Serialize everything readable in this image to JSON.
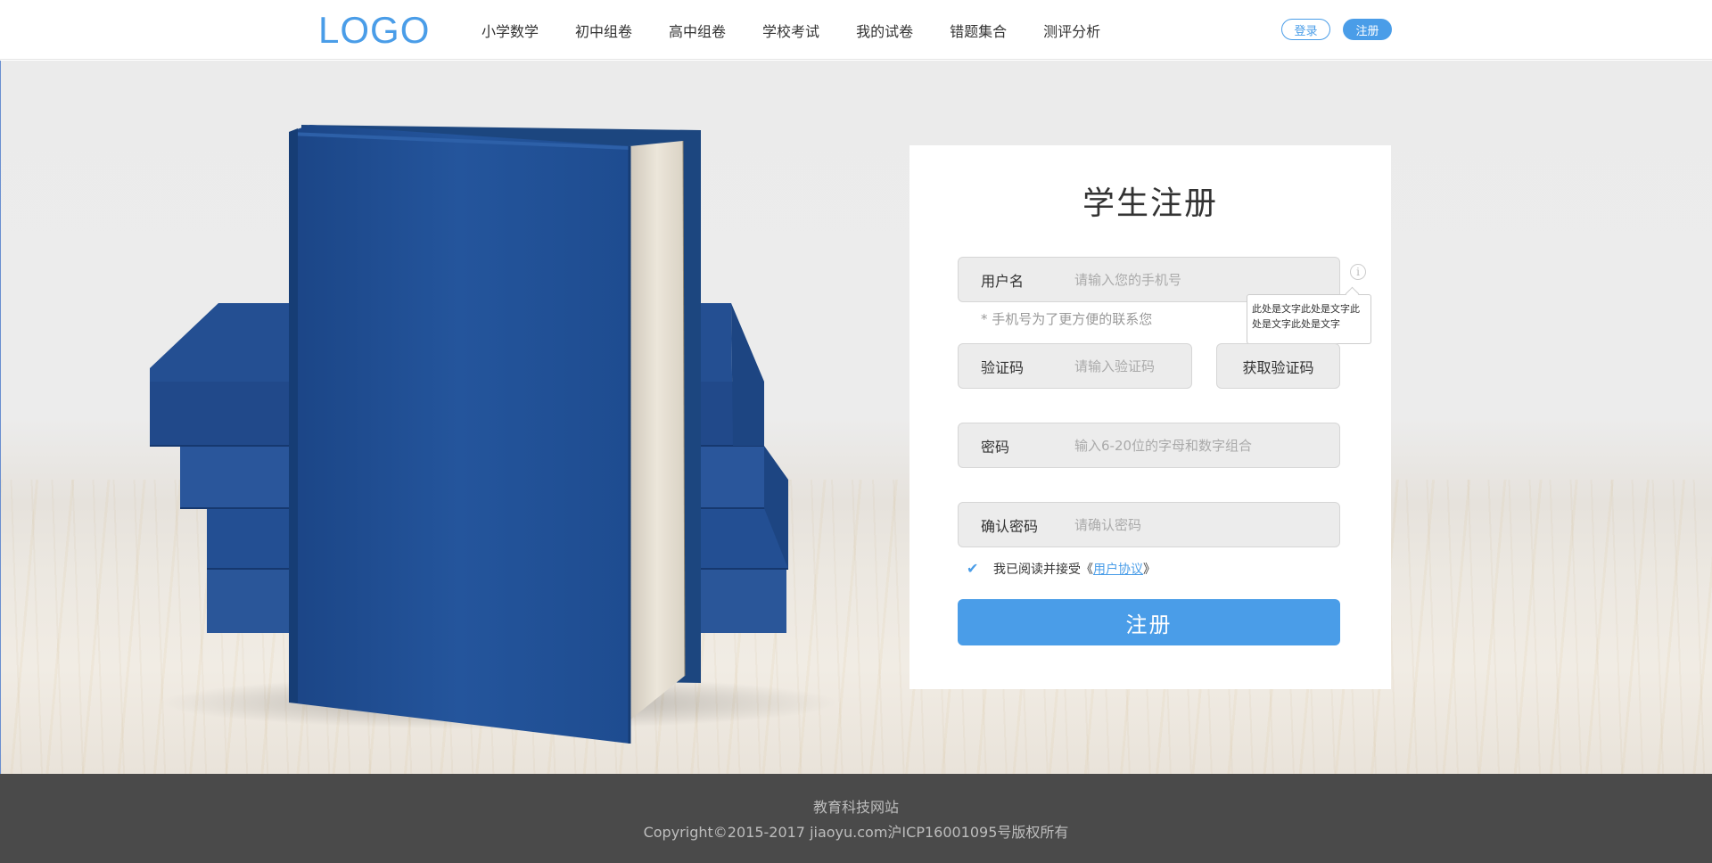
{
  "header": {
    "logo": "LOGO",
    "nav": [
      "小学数学",
      "初中组卷",
      "高中组卷",
      "学校考试",
      "我的试卷",
      "错题集合",
      "测评分析"
    ],
    "login_label": "登录",
    "register_label": "注册"
  },
  "form": {
    "title": "学生注册",
    "username": {
      "label": "用户名",
      "placeholder": "请输入您的手机号"
    },
    "username_hint": "* 手机号为了更方便的联系您",
    "tooltip": "此处是文字此处是文字此处是文字此处是文字",
    "code": {
      "label": "验证码",
      "placeholder": "请输入验证码"
    },
    "get_code_label": "获取验证码",
    "password": {
      "label": "密码",
      "placeholder": "输入6-20位的字母和数字组合"
    },
    "confirm": {
      "label": "确认密码",
      "placeholder": "请确认密码"
    },
    "agree_prefix": "我已阅读并接受《",
    "agree_link": "用户协议",
    "agree_suffix": "》",
    "agree_checked": true,
    "submit_label": "注册"
  },
  "footer": {
    "title": "教育科技网站",
    "copyright": "Copyright©2015-2017 jiaoyu.com沪ICP16001095号版权所有"
  },
  "colors": {
    "accent": "#4a9de8",
    "book": "#1f4f92",
    "footer_bg": "#4a4a4a"
  }
}
